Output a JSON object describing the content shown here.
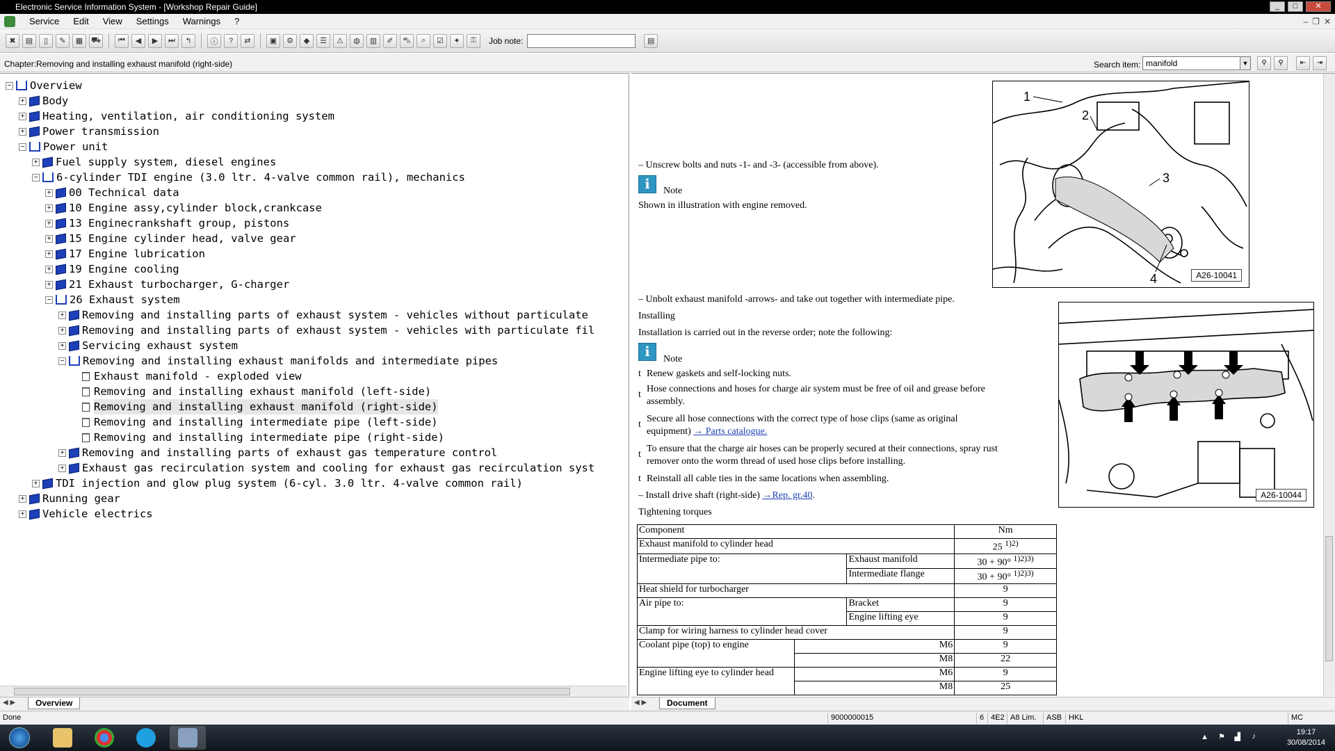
{
  "window": {
    "title": "Electronic Service Information System - [Workshop Repair Guide]"
  },
  "menu": {
    "items": [
      "Service",
      "Edit",
      "View",
      "Settings",
      "Warnings",
      "?"
    ]
  },
  "toolbar": {
    "job_note_label": "Job note:",
    "job_note_value": ""
  },
  "chapter": {
    "text": "Chapter:Removing and installing exhaust manifold (right-side)"
  },
  "search": {
    "label": "Search item:",
    "value": "manifold"
  },
  "tree": [
    {
      "label": "Overview",
      "exp": "−",
      "icon": "open-book"
    },
    {
      "label": "Body",
      "exp": "+",
      "icon": "book"
    },
    {
      "label": "Heating, ventilation, air conditioning system",
      "exp": "+",
      "icon": "book"
    },
    {
      "label": "Power transmission",
      "exp": "+",
      "icon": "book"
    },
    {
      "label": "Power unit",
      "exp": "−",
      "icon": "open-book"
    },
    {
      "label": "Fuel supply system, diesel engines",
      "exp": "+",
      "icon": "book"
    },
    {
      "label": "6-cylinder TDI engine (3.0 ltr. 4-valve common rail), mechanics",
      "exp": "−",
      "icon": "open-book"
    },
    {
      "label": "00 Technical data",
      "exp": "+",
      "icon": "book"
    },
    {
      "label": "10 Engine assy,cylinder block,crankcase",
      "exp": "+",
      "icon": "book"
    },
    {
      "label": "13 Enginecrankshaft group, pistons",
      "exp": "+",
      "icon": "book"
    },
    {
      "label": "15 Engine cylinder head, valve gear",
      "exp": "+",
      "icon": "book"
    },
    {
      "label": "17 Engine lubrication",
      "exp": "+",
      "icon": "book"
    },
    {
      "label": "19 Engine cooling",
      "exp": "+",
      "icon": "book"
    },
    {
      "label": "21 Exhaust turbocharger, G-charger",
      "exp": "+",
      "icon": "book"
    },
    {
      "label": "26 Exhaust system",
      "exp": "−",
      "icon": "open-book"
    },
    {
      "label": "Removing and installing parts of exhaust system - vehicles without particulate",
      "exp": "+",
      "icon": "book"
    },
    {
      "label": "Removing and installing parts of exhaust system - vehicles with particulate fil",
      "exp": "+",
      "icon": "book"
    },
    {
      "label": "Servicing exhaust system",
      "exp": "+",
      "icon": "book"
    },
    {
      "label": "Removing and installing exhaust manifolds and intermediate pipes",
      "exp": "−",
      "icon": "open-book"
    },
    {
      "label": "Exhaust manifold - exploded view",
      "exp": "",
      "icon": "page"
    },
    {
      "label": "Removing and installing exhaust manifold (left-side)",
      "exp": "",
      "icon": "page"
    },
    {
      "label": "Removing and installing exhaust manifold (right-side)",
      "exp": "",
      "icon": "page",
      "selected": true
    },
    {
      "label": "Removing and installing intermediate pipe (left-side)",
      "exp": "",
      "icon": "page"
    },
    {
      "label": "Removing and installing intermediate pipe (right-side)",
      "exp": "",
      "icon": "page"
    },
    {
      "label": "Removing and installing parts of exhaust gas temperature control",
      "exp": "+",
      "icon": "book"
    },
    {
      "label": "Exhaust gas recirculation system and cooling for exhaust gas recirculation syst",
      "exp": "+",
      "icon": "book"
    },
    {
      "label": "TDI injection and glow plug system (6-cyl. 3.0 ltr. 4-valve common rail)",
      "exp": "+",
      "icon": "book"
    },
    {
      "label": "Running gear",
      "exp": "+",
      "icon": "book"
    },
    {
      "label": "Vehicle electrics",
      "exp": "+",
      "icon": "book"
    }
  ],
  "tabs": {
    "left": "Overview",
    "right": "Document"
  },
  "doc": {
    "step1": "–  Unscrew bolts and nuts -1- and -3- (accessible from above).",
    "note_label": "Note",
    "note1": "Shown in illustration with engine removed.",
    "fig1_label": "A26-10041",
    "fig1_callouts": [
      "1",
      "2",
      "3",
      "4"
    ],
    "step2": "–  Unbolt exhaust manifold -arrows- and take out together with intermediate pipe.",
    "installing": "Installing",
    "install_intro": "Installation is carried out in the reverse order; note the following:",
    "bullet_char": "t",
    "b1": "Renew gaskets and self-locking nuts.",
    "b2a": "Hose connections and hoses for charge air system must be free of oil and grease before",
    "b2b": "assembly.",
    "b3a": "Secure all hose connections with the correct type of hose clips (same as original",
    "b3b_text": "equipment)",
    "b3b_link": "→ Parts catalogue.",
    "b4a": "To ensure that the charge air hoses can be properly secured at their connections, spray rust",
    "b4b": "remover onto the worm thread of used hose clips before installing.",
    "b5": "Reinstall all cable ties in the same locations when assembling.",
    "step3_text": "–  Install drive shaft (right-side)",
    "step3_link": "→Rep. gr.40",
    "fig2_label": "A26-10044",
    "torques_title": "Tightening torques"
  },
  "torque_table": {
    "header": {
      "component": "Component",
      "unit": "Nm"
    },
    "r1": {
      "component": "Exhaust manifold to cylinder head",
      "value": "25",
      "sup": "1)2)"
    },
    "r2": {
      "component": "Intermediate pipe to:",
      "sub1": "Exhaust manifold",
      "v1": "30 + 90°",
      "s1": "1)2)3)",
      "sub2": "Intermediate flange",
      "v2": "30 + 90°",
      "s2": "1)2)3)"
    },
    "r3": {
      "component": "Heat shield for turbocharger",
      "value": "9"
    },
    "r4": {
      "component": "Air pipe to:",
      "sub1": "Bracket",
      "v1": "9",
      "sub2": "Engine lifting eye",
      "v2": "9"
    },
    "r5": {
      "component": "Clamp for wiring harness to cylinder head cover",
      "value": "9"
    },
    "r6": {
      "component": "Coolant pipe (top) to engine",
      "sub1": "M6",
      "v1": "9",
      "sub2": "M8",
      "v2": "22"
    },
    "r7": {
      "component": "Engine lifting eye to cylinder head",
      "sub1": "M6",
      "v1": "9",
      "sub2": "M8",
      "v2": "25"
    }
  },
  "status": {
    "text": "Done",
    "c1": "9000000015",
    "c2": "6",
    "c3": "4E2",
    "c4": "A8 Lim.",
    "c5": "ASB",
    "c6": "HKL",
    "c7": "MC"
  },
  "clock": {
    "time": "19:17",
    "date": "30/08/2014"
  }
}
